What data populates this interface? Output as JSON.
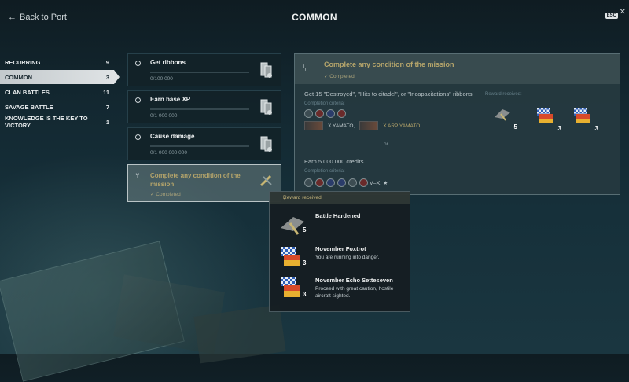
{
  "topbar": {
    "back_label": "Back to Port",
    "title": "COMMON",
    "esc_label": "ESC"
  },
  "sidebar": {
    "items": [
      {
        "label": "RECURRING",
        "count": "9"
      },
      {
        "label": "COMMON",
        "count": "3",
        "active": true
      },
      {
        "label": "CLAN BATTLES",
        "count": "11"
      },
      {
        "label": "SAVAGE BATTLE",
        "count": "7"
      },
      {
        "label": "KNOWLEDGE IS THE KEY TO VICTORY",
        "count": "1"
      }
    ]
  },
  "missions": [
    {
      "title": "Get ribbons",
      "progress": "0/100 000"
    },
    {
      "title": "Earn base XP",
      "progress": "0/1 000 000"
    },
    {
      "title": "Cause damage",
      "progress": "0/1 000 000 000"
    },
    {
      "title": "Complete any condition of the mission",
      "status": "Completed",
      "selected": true
    }
  ],
  "detail": {
    "title": "Complete any condition of the mission",
    "status": "Completed",
    "condition1": "Get 15 \"Destroyed\", \"Hits to citadel\", or \"Incapacitations\" ribbons",
    "criteria_label": "Completion criteria:",
    "ships": [
      "X YAMATO,",
      "X ARP YAMATO"
    ],
    "or_label": "or",
    "condition2": "Earn 5 000 000 credits",
    "criteria2_label": "Completion criteria:",
    "tiers": "V–X, ★",
    "reward_label": "Reward received:",
    "rewards": [
      {
        "icon": "camouflage-icon",
        "count": "5"
      },
      {
        "icon": "signal-flag-icon",
        "count": "3"
      },
      {
        "icon": "signal-flag-icon",
        "count": "3"
      }
    ]
  },
  "tooltip": {
    "header": "Reward received:",
    "items": [
      {
        "name": "Battle Hardened",
        "desc": "",
        "count": "5"
      },
      {
        "name": "November Foxtrot",
        "desc": "You are running into danger.",
        "count": "3"
      },
      {
        "name": "November Echo Setteseven",
        "desc": "Proceed with great caution, hostile aircraft sighted.",
        "count": "3"
      }
    ]
  },
  "colors": {
    "accent_gold": "#b7a66b",
    "active_tab": "#dfe3e5",
    "panel": "#263a40"
  }
}
